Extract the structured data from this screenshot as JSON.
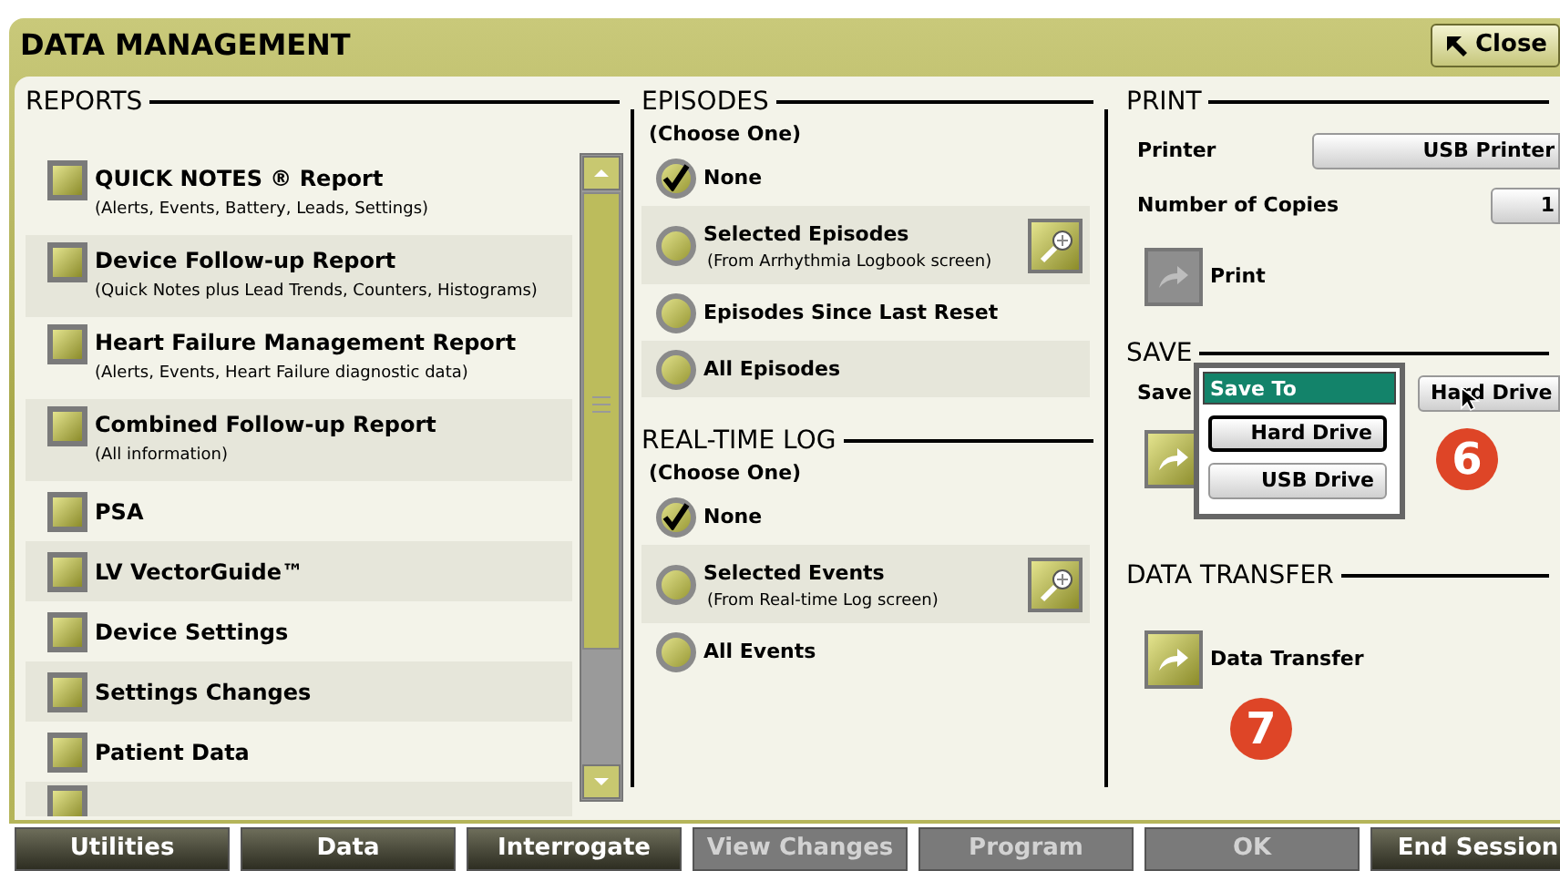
{
  "window": {
    "title": "DATA MANAGEMENT",
    "close_button": "Close"
  },
  "reports": {
    "title": "REPORTS",
    "items": [
      {
        "label": "QUICK NOTES ® Report",
        "note": "(Alerts, Events, Battery, Leads, Settings)",
        "checked": false
      },
      {
        "label": "Device Follow-up Report",
        "note": "(Quick Notes plus Lead Trends, Counters, Histograms)",
        "checked": false
      },
      {
        "label": "Heart Failure Management Report",
        "note": "(Alerts, Events, Heart Failure diagnostic data)",
        "checked": false
      },
      {
        "label": "Combined Follow-up Report",
        "note": "(All information)",
        "checked": false
      },
      {
        "label": "PSA",
        "checked": false
      },
      {
        "label": "LV VectorGuide™",
        "checked": false
      },
      {
        "label": "Device Settings",
        "checked": false
      },
      {
        "label": "Settings Changes",
        "checked": false
      },
      {
        "label": "Patient Data",
        "checked": false
      },
      {
        "kind": "cut_off",
        "checked": false
      }
    ]
  },
  "episodes": {
    "title": "EPISODES",
    "hint": "(Choose One)",
    "options": [
      {
        "label": "None",
        "selected": true,
        "zoom": false
      },
      {
        "label": "Selected Episodes",
        "note": "(From Arrhythmia Logbook screen)",
        "selected": false,
        "zoom": true
      },
      {
        "label": "Episodes Since Last Reset",
        "selected": false,
        "zoom": false
      },
      {
        "label": "All Episodes",
        "selected": false,
        "zoom": false
      }
    ]
  },
  "real_time_log": {
    "title": "REAL-TIME LOG",
    "hint": "(Choose One)",
    "options": [
      {
        "label": "None",
        "selected": true,
        "zoom": false
      },
      {
        "label": "Selected Events",
        "note": "(From Real-time Log screen)",
        "selected": false,
        "zoom": true
      },
      {
        "label": "All Events",
        "selected": false,
        "zoom": false
      }
    ]
  },
  "print": {
    "title": "PRINT",
    "printer_label": "Printer",
    "printer_value": "USB Printer",
    "copies_label": "Number of Copies",
    "copies_value": "1",
    "button": {
      "label": "Print",
      "disabled": true
    }
  },
  "save": {
    "title": "SAVE",
    "label": "Save",
    "value": "Hard Drive",
    "button_disabled": false,
    "popup": {
      "title": "Save To",
      "options": [
        {
          "label": "Hard Drive",
          "selected": true
        },
        {
          "label": "USB Drive",
          "selected": false
        }
      ]
    }
  },
  "data_transfer": {
    "title": "DATA TRANSFER",
    "button": {
      "label": "Data Transfer",
      "disabled": false
    }
  },
  "callouts": [
    "6",
    "7"
  ],
  "toolbar": [
    {
      "label": "Utilities",
      "disabled": false
    },
    {
      "label": "Data",
      "disabled": false
    },
    {
      "label": "Interrogate",
      "disabled": false
    },
    {
      "label": "View Changes",
      "disabled": true
    },
    {
      "label": "Program",
      "disabled": true
    },
    {
      "label": "OK",
      "disabled": true
    },
    {
      "label": "End Session",
      "disabled": false
    }
  ]
}
